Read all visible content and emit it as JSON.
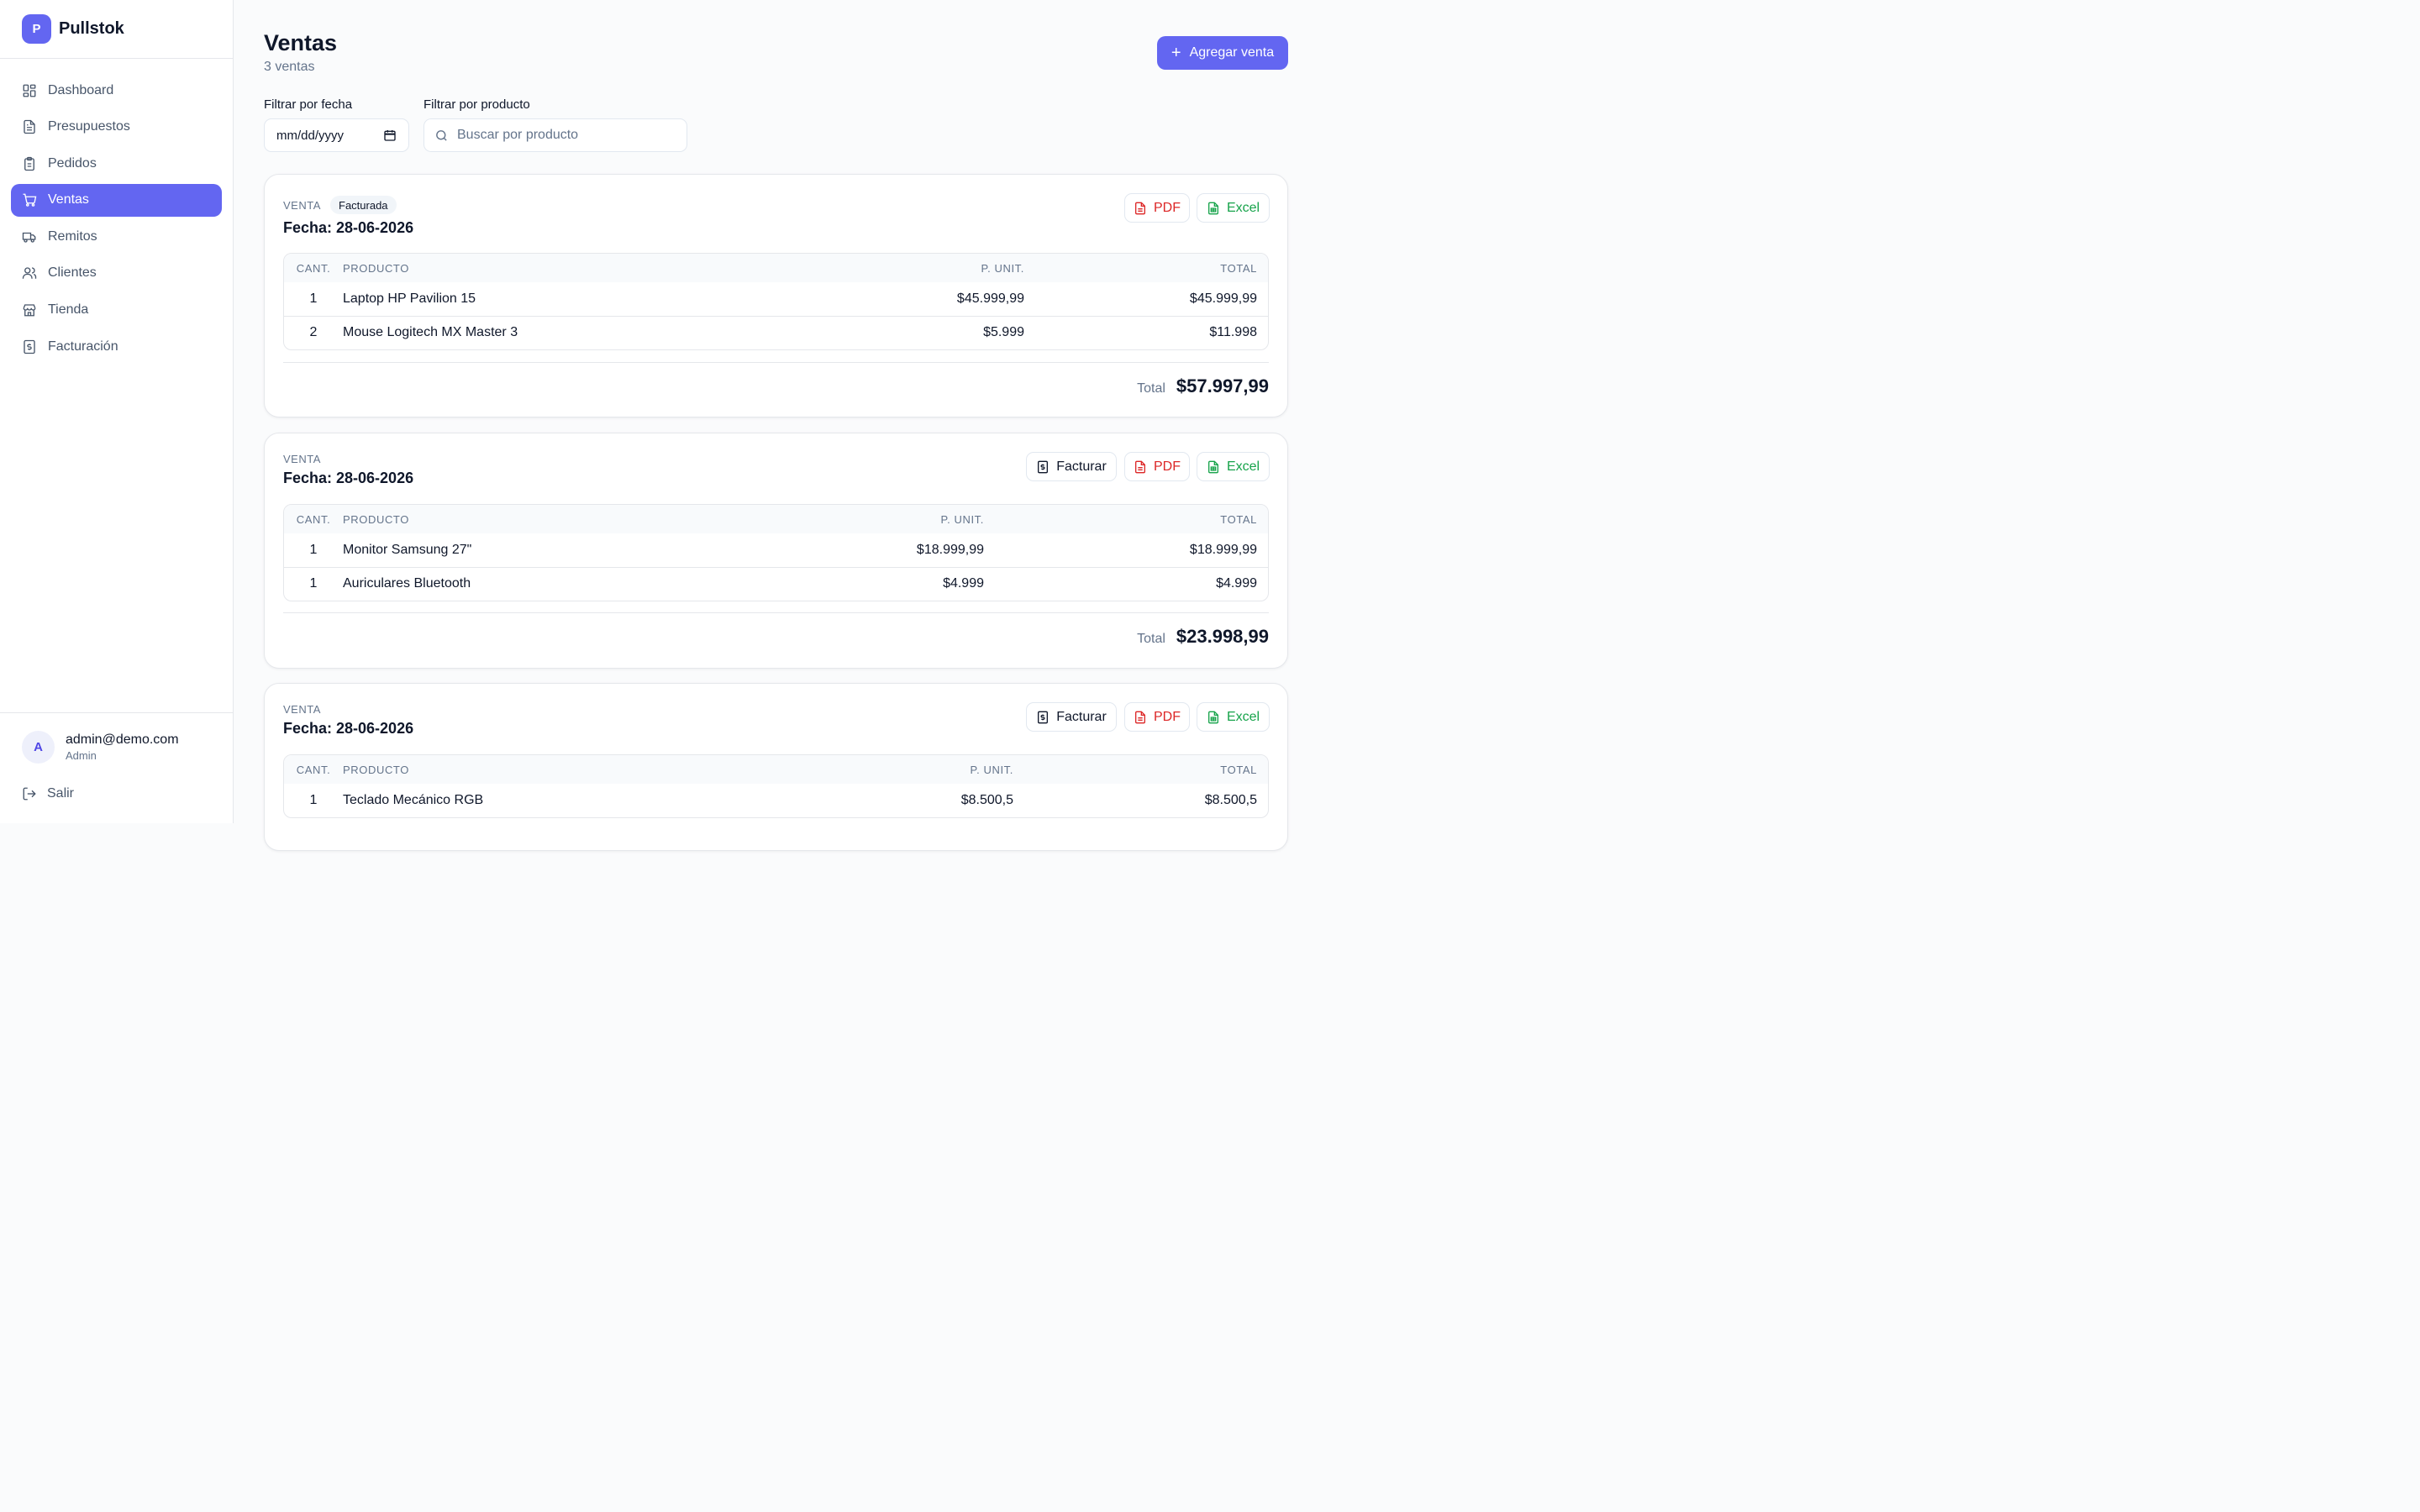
{
  "app": {
    "logo_letter": "P",
    "name": "Pullstok"
  },
  "sidebar": {
    "items": [
      {
        "label": "Dashboard",
        "icon": "dashboard-icon"
      },
      {
        "label": "Presupuestos",
        "icon": "document-icon"
      },
      {
        "label": "Pedidos",
        "icon": "clipboard-icon"
      },
      {
        "label": "Ventas",
        "icon": "cart-icon",
        "active": true
      },
      {
        "label": "Remitos",
        "icon": "truck-icon"
      },
      {
        "label": "Clientes",
        "icon": "users-icon"
      },
      {
        "label": "Tienda",
        "icon": "store-icon"
      },
      {
        "label": "Facturación",
        "icon": "receipt-icon"
      }
    ]
  },
  "user": {
    "avatar_letter": "A",
    "email": "admin@demo.com",
    "role": "Admin",
    "logout_label": "Salir"
  },
  "header": {
    "title": "Ventas",
    "subtitle": "3 ventas",
    "add_button": "Agregar venta"
  },
  "filters": {
    "date_label": "Filtrar por fecha",
    "date_value": "mm/dd/yyyy",
    "product_label": "Filtrar por producto",
    "product_placeholder": "Buscar por producto"
  },
  "sales": [
    {
      "kicker": "VENTA",
      "badge": "Facturada",
      "date": "Fecha: 28-06-2026",
      "buttons": {
        "pdf": "PDF",
        "excel": "Excel"
      },
      "columns": [
        "CANT.",
        "PRODUCTO",
        "P. UNIT.",
        "TOTAL"
      ],
      "rows": [
        {
          "qty": "1",
          "product": "Laptop HP Pavilion 15",
          "unit": "$45.999,99",
          "total": "$45.999,99"
        },
        {
          "qty": "2",
          "product": "Mouse Logitech MX Master 3",
          "unit": "$5.999",
          "total": "$11.998"
        }
      ],
      "total_label": "Total",
      "total_value": "$57.997,99"
    },
    {
      "kicker": "VENTA",
      "date": "Fecha: 28-06-2026",
      "buttons": {
        "facturar": "Facturar",
        "pdf": "PDF",
        "excel": "Excel"
      },
      "columns": [
        "CANT.",
        "PRODUCTO",
        "P. UNIT.",
        "TOTAL"
      ],
      "rows": [
        {
          "qty": "1",
          "product": "Monitor Samsung 27\"",
          "unit": "$18.999,99",
          "total": "$18.999,99"
        },
        {
          "qty": "1",
          "product": "Auriculares Bluetooth",
          "unit": "$4.999",
          "total": "$4.999"
        }
      ],
      "total_label": "Total",
      "total_value": "$23.998,99"
    },
    {
      "kicker": "VENTA",
      "date": "Fecha: 28-06-2026",
      "buttons": {
        "facturar": "Facturar",
        "pdf": "PDF",
        "excel": "Excel"
      },
      "columns": [
        "CANT.",
        "PRODUCTO",
        "P. UNIT.",
        "TOTAL"
      ],
      "rows": [
        {
          "qty": "1",
          "product": "Teclado Mecánico RGB",
          "unit": "$8.500,5",
          "total": "$8.500,5"
        }
      ]
    }
  ],
  "colors": {
    "accent": "#6366f1",
    "pdf": "#dc2626",
    "excel": "#16a34a",
    "text": "#0f172a",
    "muted": "#64748b"
  }
}
